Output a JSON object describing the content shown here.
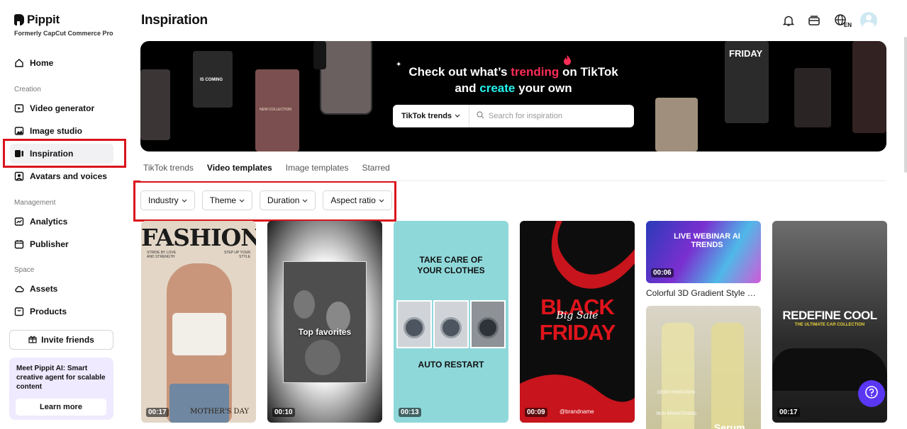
{
  "brand": {
    "name": "Pippit",
    "tagline": "Formerly CapCut Commerce Pro"
  },
  "sidebar": {
    "home": "Home",
    "sections": {
      "creation": "Creation",
      "management": "Management",
      "space": "Space"
    },
    "creation_items": [
      "Video generator",
      "Image studio",
      "Inspiration",
      "Avatars and voices"
    ],
    "management_items": [
      "Analytics",
      "Publisher"
    ],
    "space_items": [
      "Assets",
      "Products"
    ],
    "invite_label": "Invite friends",
    "promo": {
      "text": "Meet Pippit AI: Smart creative agent for scalable content",
      "button": "Learn more"
    }
  },
  "header": {
    "title": "Inspiration",
    "lang_badge": "EN"
  },
  "banner": {
    "line1_pre": "Check out what’s ",
    "line1_hl": "trending",
    "line1_post": " on TikTok",
    "line2_pre": "and ",
    "line2_hl": "create",
    "line2_post": " your own",
    "search_select": "TikTok trends",
    "search_placeholder": "Search for inspiration",
    "deco": {
      "friday": "FRIDAY",
      "coming": "IS COMING",
      "new_collection": "NEW COLLECTION"
    }
  },
  "tabs": [
    "TikTok trends",
    "Video templates",
    "Image templates",
    "Starred"
  ],
  "active_tab": "Video templates",
  "filters": [
    "Industry",
    "Theme",
    "Duration",
    "Aspect ratio"
  ],
  "templates": [
    {
      "duration": "00:17",
      "title_text": "FASHION",
      "subtitle_left": "STRIDE BY LOVE AND STRENGTH",
      "subtitle_right": "STEP UP YOUR STYLE",
      "bottom_text": "MOTHER'S DAY"
    },
    {
      "duration": "00:10",
      "overlay": "Top favorites"
    },
    {
      "duration": "00:13",
      "top_text": "TAKE CARE OF YOUR CLOTHES",
      "bottom_text": "AUTO RESTART"
    },
    {
      "duration": "00:09",
      "line1": "BLACK",
      "script": "Big Sale",
      "line2": "FRIDAY",
      "handle": "@brandname"
    },
    {
      "duration": "00:06",
      "title": "LIVE WEBINAR AI TRENDS",
      "caption": "Colorful 3D Gradient Style Co..."
    },
    {
      "title": "Serum",
      "label1": "DEEP HYDRATION",
      "label2": "SKIN BRIGHTENING"
    },
    {
      "duration": "00:17",
      "title": "REDEFINE COOL",
      "sub": "THE ULTIMATE CAR COLLECTION"
    }
  ],
  "colors": {
    "highlight": "#d9141c",
    "tiktok_pink": "#fe2c55",
    "tiktok_cyan": "#25f4ee",
    "help_button": "#5a37f5"
  }
}
